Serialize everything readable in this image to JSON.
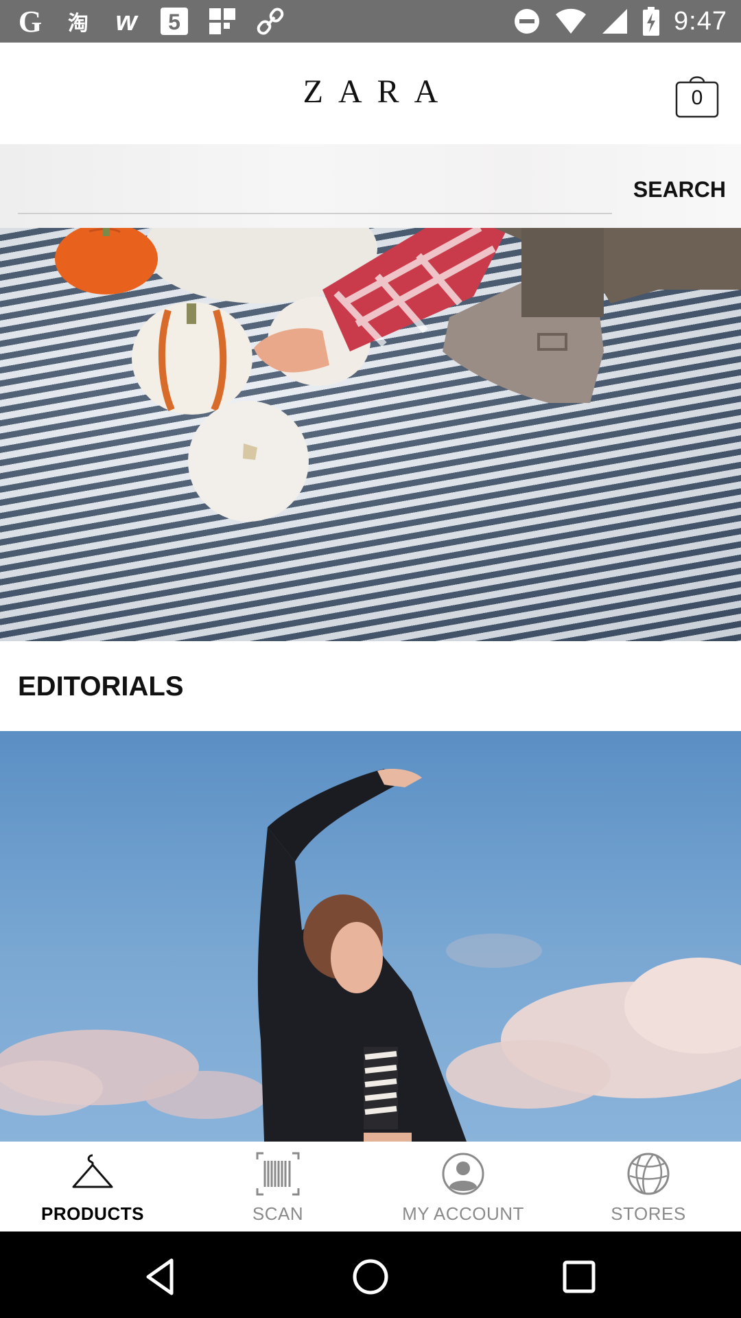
{
  "status_bar": {
    "time": "9:47",
    "left_icons": [
      "google-icon",
      "taobao-icon",
      "weibo-icon",
      "app-5-icon",
      "grid-app-icon",
      "link-icon"
    ],
    "right_icons": [
      "do-not-disturb-icon",
      "wifi-icon",
      "signal-icon",
      "battery-charging-icon"
    ]
  },
  "header": {
    "logo": "ZARA",
    "cart_count": "0"
  },
  "search": {
    "label": "SEARCH",
    "placeholder": ""
  },
  "sections": {
    "editorials_title": "EDITORIALS"
  },
  "bottom_nav": [
    {
      "label": "PRODUCTS",
      "icon": "hanger-icon",
      "active": true
    },
    {
      "label": "SCAN",
      "icon": "barcode-icon",
      "active": false
    },
    {
      "label": "MY ACCOUNT",
      "icon": "account-icon",
      "active": false
    },
    {
      "label": "STORES",
      "icon": "globe-icon",
      "active": false
    }
  ],
  "colors": {
    "status_bar": "#6f6f6f",
    "sky": "#6e9ed0",
    "stripe_dark": "#3f5168",
    "pumpkin_orange": "#e8621e"
  }
}
